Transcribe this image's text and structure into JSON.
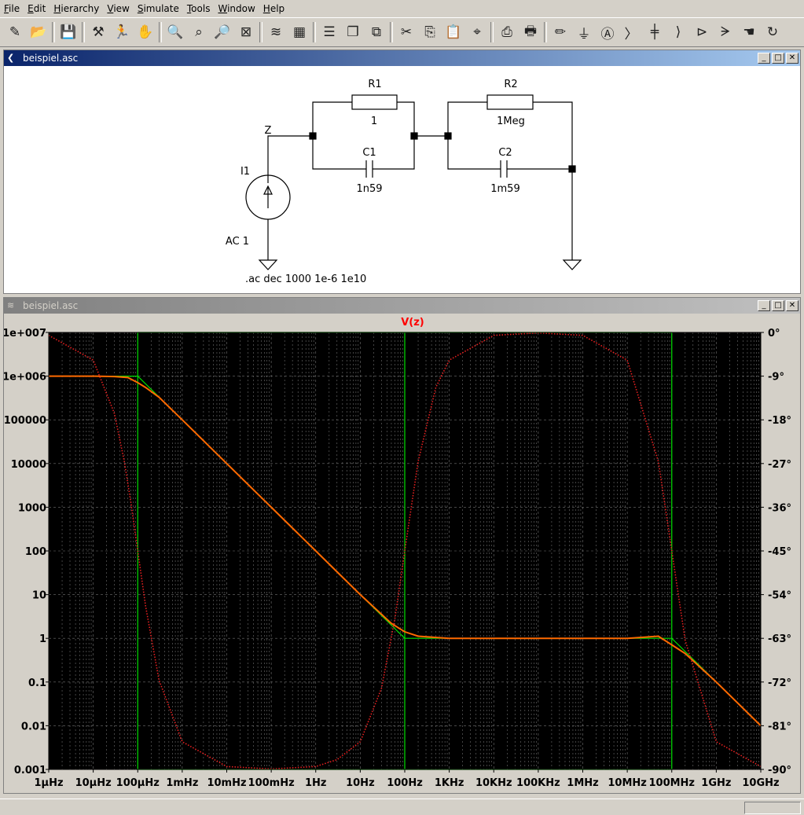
{
  "menu": [
    "File",
    "Edit",
    "Hierarchy",
    "View",
    "Simulate",
    "Tools",
    "Window",
    "Help"
  ],
  "toolbar_icons": [
    "new-schematic-icon",
    "open-icon",
    "save-icon",
    "control-panel-icon",
    "run-icon",
    "halt-icon",
    "zoom-in-icon",
    "zoom-pan-icon",
    "zoom-out-icon",
    "zoom-fit-icon",
    "autorange-icon",
    "plot-settings-icon",
    "tile-horizontal-icon",
    "cascade-icon",
    "tile-vertical-icon",
    "cut-icon",
    "copy-icon",
    "paste-icon",
    "find-icon",
    "print-icon",
    "print-setup-icon",
    "draw-wire-icon",
    "ground-icon",
    "label-net-icon",
    "resistor-icon",
    "capacitor-icon",
    "inductor-icon",
    "diode-icon",
    "component-icon",
    "move-icon",
    "rotate-icon"
  ],
  "schematic_window": {
    "title": "beispiel.asc",
    "labels": {
      "r1_name": "R1",
      "r1_value": "1",
      "r2_name": "R2",
      "r2_value": "1Meg",
      "c1_name": "C1",
      "c1_value": "1n59",
      "c2_name": "C2",
      "c2_value": "1m59",
      "i1_name": "I1",
      "i1_value": "AC 1",
      "net_label": "Z",
      "directive": ".ac dec 1000 1e-6 1e10"
    }
  },
  "waveform_window": {
    "title": "beispiel.asc"
  },
  "chart_data": {
    "type": "line",
    "title": "V(z)",
    "x_scale": "log",
    "xlim": [
      "1µHz",
      "10GHz"
    ],
    "x_ticks": [
      "1µHz",
      "10µHz",
      "100µHz",
      "1mHz",
      "10mHz",
      "100mHz",
      "1Hz",
      "10Hz",
      "100Hz",
      "1KHz",
      "10KHz",
      "100KHz",
      "1MHz",
      "10MHz",
      "100MHz",
      "1GHz",
      "10GHz"
    ],
    "y_left_scale": "log",
    "y_left_ticks": [
      "1e+007",
      "1e+006",
      "100000",
      "10000",
      "1000",
      "100",
      "10",
      "1",
      "0.1",
      "0.01",
      "0.001"
    ],
    "y_right_ticks": [
      "0°",
      "-9°",
      "-18°",
      "-27°",
      "-36°",
      "-45°",
      "-54°",
      "-63°",
      "-72°",
      "-81°",
      "-90°"
    ],
    "grid": true,
    "colors": {
      "magnitude": "#ff6a00",
      "phase": "#e82020",
      "asymptote": "#00e000",
      "background": "#000000",
      "title": "#ff0000"
    },
    "series": [
      {
        "name": "V(z)",
        "style": "solid",
        "x_hz": [
          1e-06,
          1e-05,
          3e-05,
          6e-05,
          0.0001,
          0.00015,
          0.0003,
          0.001,
          0.01,
          0.1,
          1,
          10,
          50,
          100,
          200,
          1000,
          10000.0,
          100000.0,
          1000000.0,
          10000000.0,
          50000000.0,
          100000000.0,
          200000000.0,
          1000000000.0,
          10000000000.0
        ],
        "y_ohm": [
          1000000.0,
          1000000.0,
          980000.0,
          930000.0,
          710000.0,
          550000.0,
          330000.0,
          100000.0,
          10000.0,
          1000.0,
          100,
          10,
          2.2,
          1.41,
          1.12,
          1,
          1,
          1,
          1,
          1,
          1.12,
          0.71,
          0.45,
          0.1,
          0.01
        ]
      },
      {
        "name": "phase",
        "style": "dotted",
        "x_hz": [
          1e-06,
          1e-05,
          3e-05,
          5e-05,
          7e-05,
          0.0001,
          0.00015,
          0.0003,
          0.001,
          0.01,
          0.1,
          1,
          3,
          10,
          30,
          60,
          100,
          200,
          500,
          1000.0,
          10000.0,
          100000.0,
          1000000.0,
          10000000.0,
          50000000.0,
          100000000.0,
          200000000.0,
          1000000000.0,
          10000000000.0
        ],
        "y_deg": [
          -0.6,
          -5.7,
          -16.7,
          -26.6,
          -35,
          -45,
          -56.3,
          -71.6,
          -84.3,
          -89.4,
          -89.9,
          -89.4,
          -88,
          -84.3,
          -73.3,
          -59,
          -45,
          -26.6,
          -11.3,
          -5.7,
          -0.6,
          -0.1,
          -0.6,
          -5.7,
          -26.6,
          -45,
          -63.4,
          -84.3,
          -89.4
        ]
      }
    ]
  }
}
